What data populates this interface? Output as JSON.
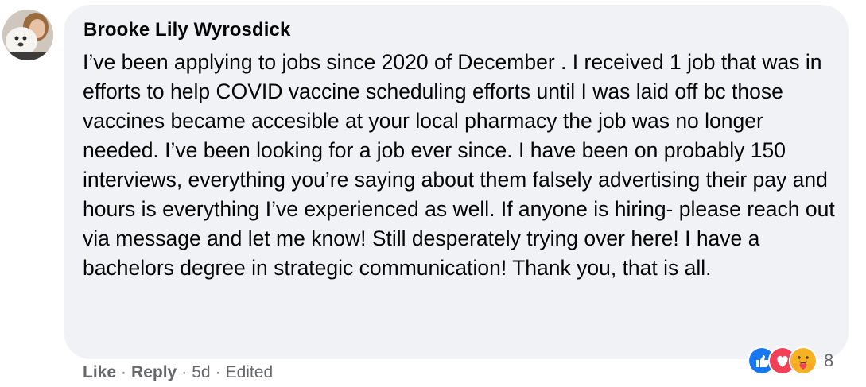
{
  "comment": {
    "author": "Brooke Lily Wyrosdick",
    "text": "I’ve been applying to jobs since 2020 of December . I received 1 job that was in efforts to help COVID vaccine scheduling efforts until I was laid off bc those vaccines became accesible at your local pharmacy the job was no longer needed. I’ve been looking for a job ever since. I have been on probably 150 interviews, everything you’re saying about them falsely advertising their pay and hours is everything I’ve experienced as well. If anyone is hiring- please reach out via message and let me know! Still desperately trying over here! I have a bachelors degree in strategic communication! Thank you, that is all.",
    "avatar_icon": "profile-photo"
  },
  "actions": {
    "like_label": "Like",
    "reply_label": "Reply",
    "separator": "·",
    "time": "5d",
    "edited_label": "Edited"
  },
  "reactions": {
    "icons": [
      "like-icon",
      "love-icon",
      "care-icon"
    ],
    "count": "8",
    "colors": {
      "like": "#1877f2",
      "love": "#f33e58",
      "care": "#f7b125"
    }
  },
  "colors": {
    "bubble": "#f0f2f5",
    "text": "#050505",
    "secondary": "#65676b"
  }
}
